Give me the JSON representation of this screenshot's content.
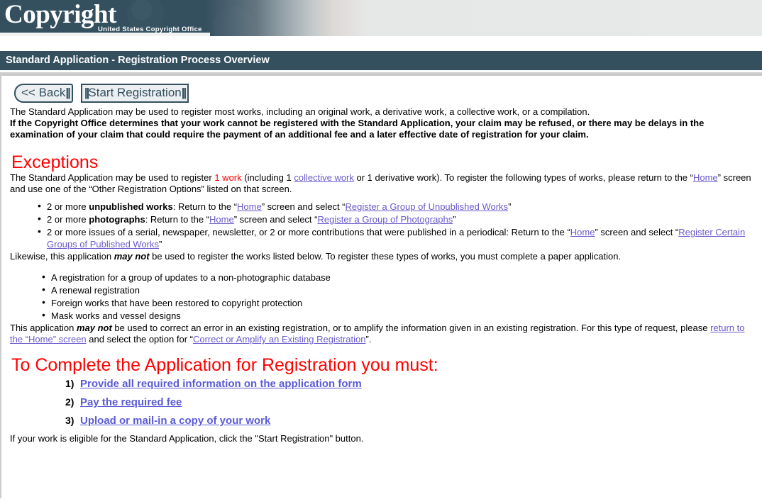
{
  "banner": {
    "logo_c": "C",
    "logo_text": "opyright",
    "logo_subtitle": "United States Copyright Office",
    "colors": {
      "dark": "#34505f",
      "light": "#e8eaea"
    }
  },
  "titlebar": {
    "title": "Standard Application - Registration Process Overview",
    "background": "#34505f",
    "text_color": "#ffffff"
  },
  "toolbar": {
    "back_label": "<< Back",
    "back_bars": "||",
    "start_bars_left": "||",
    "start_label": "Start Registration",
    "start_bars_right": "||"
  },
  "main": {
    "intro": "The Standard Application may be used to register most works, including an original work, a derivative work, a collective work, or a compilation.",
    "warning": "If the Copyright Office determines that your work cannot be registered with the Standard Application, your claim may be refused, or there may be delays in the examination of your claim that could require the payment of an additional fee and a later effective date of registration for your claim.",
    "exceptions_heading": "Exceptions",
    "exceptions_para": {
      "t1": "The Standard Application may be used to register ",
      "red1": "1 work",
      "t2": " (including 1 ",
      "link1": "collective work",
      "t3": " or 1 derivative work). To register the following types of works, please return to the “",
      "link2": "Home",
      "t4": "” screen and use one of the “Other Registration Options” listed on that screen."
    },
    "exception_bullets": [
      {
        "t1": "2 or more ",
        "bold": "unpublished works",
        "t2": ": Return to the “",
        "link1": "Home",
        "t3": "” screen and select “",
        "link2": "Register a Group of Unpublished Works",
        "t4": "”"
      },
      {
        "t1": "2 or more ",
        "bold": "photographs",
        "t2": ": Return to the “",
        "link1": "Home",
        "t3": "” screen and select “",
        "link2": "Register a Group of Photographs",
        "t4": "”"
      },
      {
        "t1": "2 or more issues of a serial, newspaper, newsletter, or 2 or more contributions that were published in a periodical: Return to the “",
        "bold": "",
        "t2": "",
        "link1": "Home",
        "t3": "” screen and select “",
        "link2": "Register Certain Groups of Published Works",
        "t4": "”"
      }
    ],
    "likewise": {
      "t1": "Likewise, this application ",
      "ital": "may not",
      "t2": " be used to register the works listed below. To register these types of works, you must complete a paper application."
    },
    "paper_bullets": [
      "A registration for a group of updates to a non-photographic database",
      "A renewal registration",
      "Foreign works that have been restored to copyright protection",
      "Mask works and vessel designs"
    ],
    "maynot": {
      "t1": "This application ",
      "ital": "may not",
      "t2": " be used to correct an error in an existing registration, or to amplify the information given in an existing registration. For this type of request, please ",
      "link1": "return to the “Home” screen",
      "t3": " and select the option for “",
      "link2": "Correct or Amplify an Existing Registration",
      "t4": "”."
    },
    "complete_heading": "To Complete the Application for Registration you must:",
    "steps": [
      {
        "num": "1)",
        "label": "Provide all required information on the application form"
      },
      {
        "num": "2)",
        "label": "Pay the required fee"
      },
      {
        "num": "3)",
        "label": "Upload or mail-in a copy of your work"
      }
    ],
    "final_note": "If your work is eligible for the Standard Application, click the \"Start Registration\" button."
  }
}
